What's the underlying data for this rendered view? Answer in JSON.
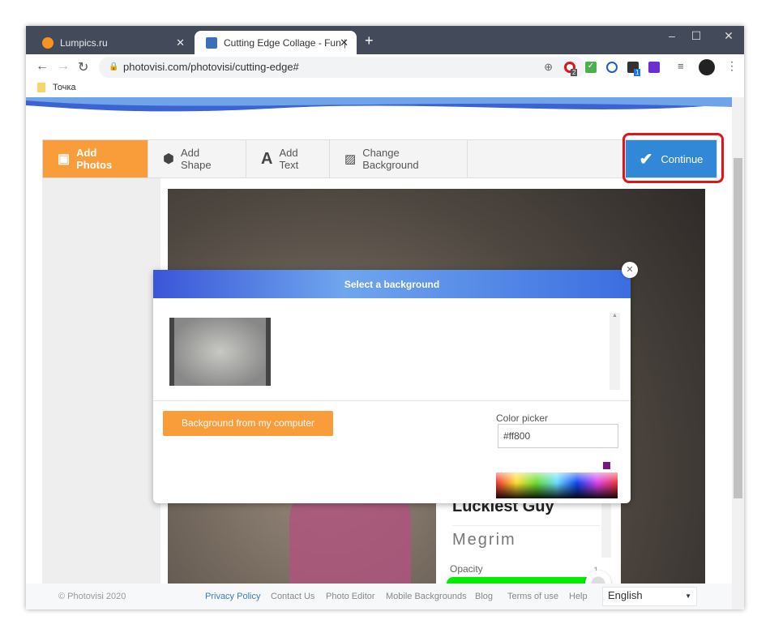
{
  "browser": {
    "tabs": [
      {
        "title": "Lumpics.ru",
        "favicon": "orange-circle"
      },
      {
        "title": "Cutting Edge Collage - Fun | Phot",
        "favicon": "photovisi"
      }
    ],
    "url": "photovisi.com/photovisi/cutting-edge#",
    "bookmark": "Точка",
    "badges": [
      "2",
      "1"
    ]
  },
  "toolbar": {
    "items": [
      {
        "label": "Add Photos",
        "icon": "photos-icon"
      },
      {
        "label": "Add Shape",
        "icon": "cube-icon"
      },
      {
        "label": "Add Text",
        "icon": "text-icon"
      },
      {
        "label": "Change Background",
        "icon": "image-icon"
      }
    ],
    "continue": "Continue"
  },
  "modal": {
    "title": "Select a background",
    "upload_button": "Background from my computer",
    "color_label": "Color picker",
    "color_value": "#ff800",
    "selected_swatch": "#7a1585"
  },
  "font_panel": {
    "font_sample_1": "Luckiest Guy",
    "font_sample_2": "Megrim",
    "opacity_label": "Opacity",
    "opacity_value": "1",
    "opacity_level": 1
  },
  "footer": {
    "copyright": "© Photovisi 2020",
    "links": [
      "Privacy Policy",
      "Contact Us",
      "Photo Editor",
      "Mobile Backgrounds",
      "Blog",
      "Terms of use",
      "Help"
    ],
    "language": "English"
  },
  "colors": {
    "accent": "#f99c3a",
    "continue": "#3088d6",
    "highlight": "#e0141c",
    "slider": "#00ee00"
  }
}
